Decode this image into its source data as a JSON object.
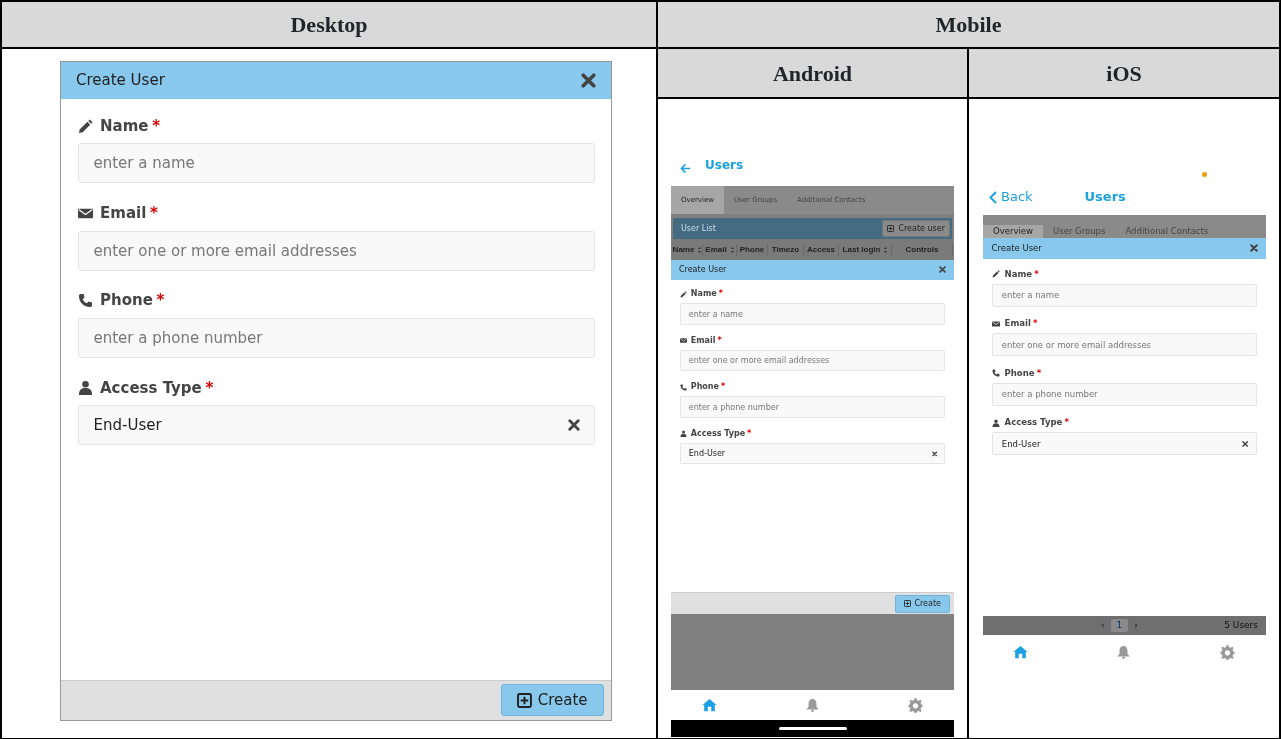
{
  "table": {
    "headers": [
      "Desktop",
      "Mobile"
    ],
    "subheaders": [
      "Android",
      "iOS"
    ]
  },
  "desktop": {
    "dialog": {
      "title": "Create User",
      "fields": [
        {
          "kind": "pencil",
          "label": "Name",
          "required": "*",
          "placeholder": "enter a name"
        },
        {
          "kind": "envelope",
          "label": "Email",
          "required": "*",
          "placeholder": "enter one or more email addresses"
        },
        {
          "kind": "phone",
          "label": "Phone",
          "required": "*",
          "placeholder": "enter a phone number"
        },
        {
          "kind": "user",
          "label": "Access Type",
          "required": "*",
          "value": "End-User",
          "clearable": true
        }
      ],
      "button": "Create"
    }
  },
  "android": {
    "title": "Users",
    "tabs": [
      {
        "label": "Overview",
        "selected": true
      },
      {
        "label": "User Groups",
        "selected": false
      },
      {
        "label": "Additional Contacts",
        "selected": false
      }
    ],
    "panel": {
      "title": "User List",
      "button": "Create user",
      "columns": [
        {
          "label": "Name",
          "sortable": true
        },
        {
          "label": "Email",
          "sortable": true
        },
        {
          "label": "Phone",
          "sortable": false
        },
        {
          "label": "Timezo",
          "sortable": false
        },
        {
          "label": "Access",
          "sortable": false
        },
        {
          "label": "Last login",
          "sortable": true
        },
        {
          "label": "Controls",
          "sortable": false
        }
      ]
    },
    "dialog": {
      "title": "Create User",
      "fields": [
        {
          "kind": "pencil",
          "label": "Name",
          "required": "*",
          "placeholder": "enter a name"
        },
        {
          "kind": "envelope",
          "label": "Email",
          "required": "*",
          "placeholder": "enter one or more email addresses"
        },
        {
          "kind": "phone",
          "label": "Phone",
          "required": "*",
          "placeholder": "enter a phone number"
        },
        {
          "kind": "user",
          "label": "Access Type",
          "required": "*",
          "value": "End-User",
          "clearable": true
        }
      ],
      "button": "Create"
    },
    "nav": [
      {
        "kind": "home",
        "selected": true
      },
      {
        "kind": "bell",
        "selected": false
      },
      {
        "kind": "gear",
        "selected": false
      }
    ]
  },
  "ios": {
    "back": "Back",
    "title": "Users",
    "tabs": [
      {
        "label": "Overview",
        "selected": true
      },
      {
        "label": "User Groups",
        "selected": false
      },
      {
        "label": "Additional Contacts",
        "selected": false
      }
    ],
    "dialog": {
      "title": "Create User",
      "fields": [
        {
          "kind": "pencil",
          "label": "Name",
          "required": "*",
          "placeholder": "enter a name"
        },
        {
          "kind": "envelope",
          "label": "Email",
          "required": "*",
          "placeholder": "enter one or more email addresses"
        },
        {
          "kind": "phone",
          "label": "Phone",
          "required": "*",
          "placeholder": "enter a phone number"
        },
        {
          "kind": "user",
          "label": "Access Type",
          "required": "*",
          "value": "End-User",
          "clearable": true
        }
      ]
    },
    "pagination": [
      {
        "label": "‹",
        "selected": false
      },
      {
        "label": "1",
        "selected": true
      },
      {
        "label": "›",
        "selected": false
      }
    ],
    "count": "5 Users",
    "nav": [
      {
        "kind": "home",
        "selected": true
      },
      {
        "kind": "bell",
        "selected": false
      },
      {
        "kind": "gear",
        "selected": false
      }
    ]
  }
}
